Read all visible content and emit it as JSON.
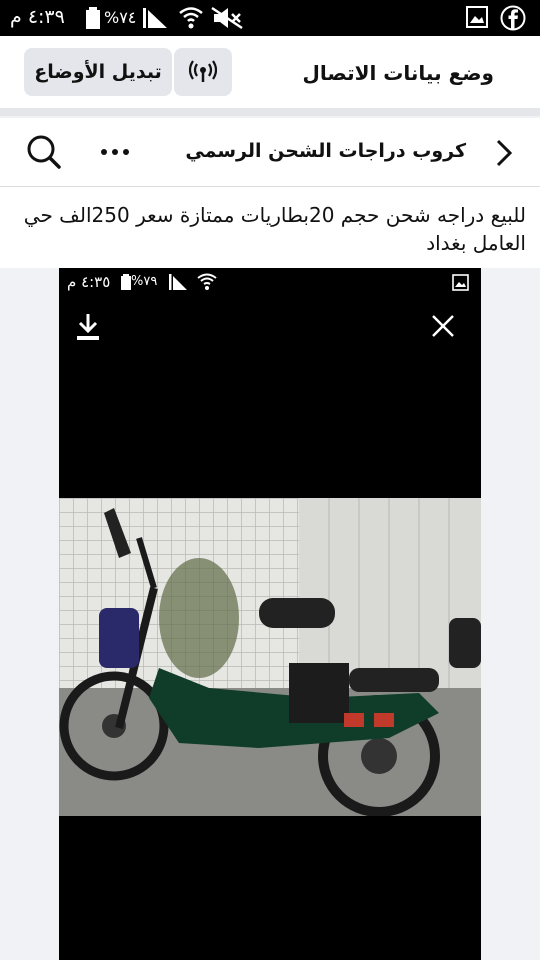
{
  "status_bar": {
    "time": "٤:٣٩ م",
    "battery_percent": "%٧٤",
    "icons": [
      "battery-icon",
      "signal-icon",
      "wifi-icon",
      "mute-icon",
      "gallery-icon",
      "facebook-icon"
    ]
  },
  "data_mode_banner": {
    "title": "وضع بيانات الاتصال",
    "toggle_label": "تبديل الأوضاع",
    "signal_icon": "broadcast-icon"
  },
  "group_header": {
    "title": "كروب دراجات الشحن الرسمي",
    "back_icon": "chevron-right-icon",
    "more_icon": "more-icon",
    "search_icon": "search-icon"
  },
  "post": {
    "text": "للبيع دراجه شحن حجم 20بطاريات ممتازة سعر 250الف حي العامل بغداد"
  },
  "photo": {
    "inner_time": "٤:٣٥ م",
    "inner_battery": "%٧٩",
    "icons": [
      "download-icon",
      "close-icon",
      "gallery-icon",
      "wifi-icon",
      "signal-icon",
      "battery-icon"
    ],
    "colors": {
      "bike_frame": "#0f3d2a",
      "seat": "#222222",
      "wall": "#d9d9d6",
      "ground": "#8a8a86"
    }
  }
}
